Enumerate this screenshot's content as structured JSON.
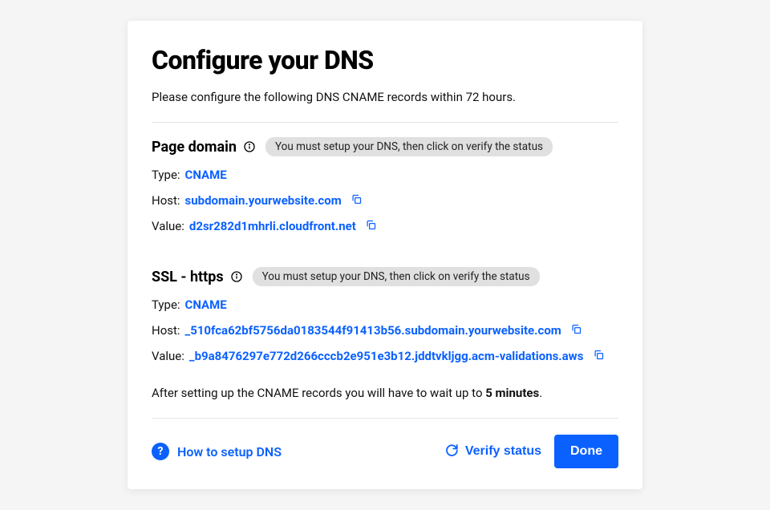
{
  "modal": {
    "title": "Configure your DNS",
    "subtitle": "Please configure the following DNS CNAME records within 72 hours."
  },
  "sections": {
    "page_domain": {
      "title": "Page domain",
      "badge": "You must setup your DNS, then click on verify the status",
      "type_label": "Type: ",
      "type_value": "CNAME",
      "host_label": "Host: ",
      "host_value": "subdomain.yourwebsite.com",
      "value_label": "Value: ",
      "value_value": "d2sr282d1mhrli.cloudfront.net"
    },
    "ssl": {
      "title": "SSL - https",
      "badge": "You must setup your DNS, then click on verify the status",
      "type_label": "Type: ",
      "type_value": "CNAME",
      "host_label": "Host: ",
      "host_value": "_510fca62bf5756da0183544f91413b56.subdomain.yourwebsite.com",
      "value_label": "Value: ",
      "value_value": "_b9a8476297e772d266cccb2e951e3b12.jddtvkljgg.acm-validations.aws"
    }
  },
  "note": {
    "prefix": "After setting up the CNAME records you will have to wait up to ",
    "bold": "5 minutes",
    "suffix": "."
  },
  "footer": {
    "help_label": "How to setup DNS",
    "verify_label": "Verify status",
    "done_label": "Done"
  }
}
